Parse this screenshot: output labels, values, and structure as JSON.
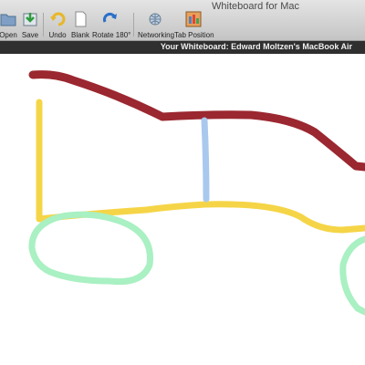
{
  "window": {
    "title": "Whiteboard for Mac"
  },
  "toolbar": {
    "open_label": "Open",
    "save_label": "Save",
    "undo_label": "Undo",
    "blank_label": "Blank",
    "rotate_label": "Rotate 180°",
    "networking_label": "Networking",
    "tab_position_label": "Tab Position"
  },
  "banner": {
    "text": "Your Whiteboard: Edward Moltzen's MacBook Air"
  },
  "icons": [
    "folder-icon",
    "save-icon",
    "undo-icon",
    "blank-page-icon",
    "rotate-icon",
    "networking-icon",
    "tab-position-icon"
  ],
  "stroke_colors": {
    "red": "#9b2730",
    "yellow": "#f5d547",
    "blue": "#a9c8ee",
    "green": "#a9f0c2"
  }
}
